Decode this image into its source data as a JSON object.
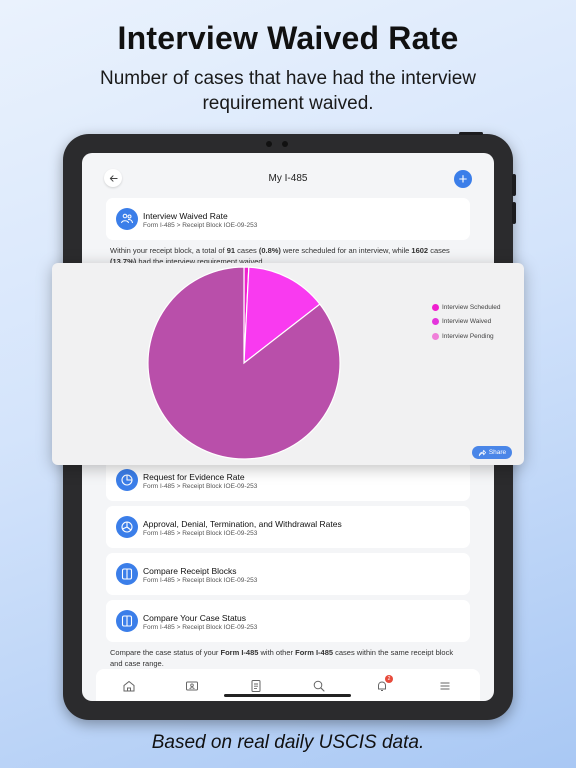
{
  "promo": {
    "headline": "Interview Waived Rate",
    "subline": "Number of cases that have had the interview requirement waived.",
    "footer": "Based on real daily USCIS data."
  },
  "nav": {
    "title": "My I-485",
    "add_label": "+"
  },
  "cards": [
    {
      "title": "Interview Waived Rate",
      "subtitle": "Form I-485 > Receipt Block IOE-09-253",
      "icon": "people-icon"
    },
    {
      "title": "Request for Evidence Rate",
      "subtitle": "Form I-485 > Receipt Block IOE-09-253",
      "icon": "pie-chart-icon"
    },
    {
      "title": "Approval, Denial, Termination, and Withdrawal Rates",
      "subtitle": "Form I-485 > Receipt Block IOE-09-253",
      "icon": "segmented-pie-icon"
    },
    {
      "title": "Compare Receipt Blocks",
      "subtitle": "Form I-485 > Receipt Block IOE-09-253",
      "icon": "compare-icon"
    },
    {
      "title": "Compare Your Case Status",
      "subtitle": "Form I-485 > Receipt Block IOE-09-253",
      "icon": "compare-status-icon"
    }
  ],
  "desc1": {
    "p1": "Within your receipt block, a total of ",
    "n1": "91",
    "p2": " cases ",
    "n2": "(0.8%)",
    "p3": " were scheduled for an interview, while ",
    "n3": "1602",
    "p4": " cases ",
    "n4": "(13.7%)",
    "p5": " had the interview requirement waived."
  },
  "desc2": {
    "p1": "Compare the case status of your ",
    "b1": "Form I-485",
    "p2": " with other ",
    "b2": "Form I-485",
    "p3": " cases within the same receipt block and case range."
  },
  "tabbar": {
    "badge": "2",
    "icons": [
      "home-icon",
      "id-card-icon",
      "document-icon",
      "search-icon",
      "bell-icon",
      "menu-icon"
    ]
  },
  "share_label": "Share",
  "colors": {
    "accent": "#3b7ee9",
    "scheduled": "#f01fcf",
    "waived": "#f93af0",
    "pending": "#b94faa"
  },
  "chart_data": {
    "type": "pie",
    "categories": [
      "Interview Scheduled",
      "Interview Waived",
      "Interview Pending"
    ],
    "values": [
      0.8,
      13.7,
      85.5
    ],
    "legend_position": "right"
  }
}
